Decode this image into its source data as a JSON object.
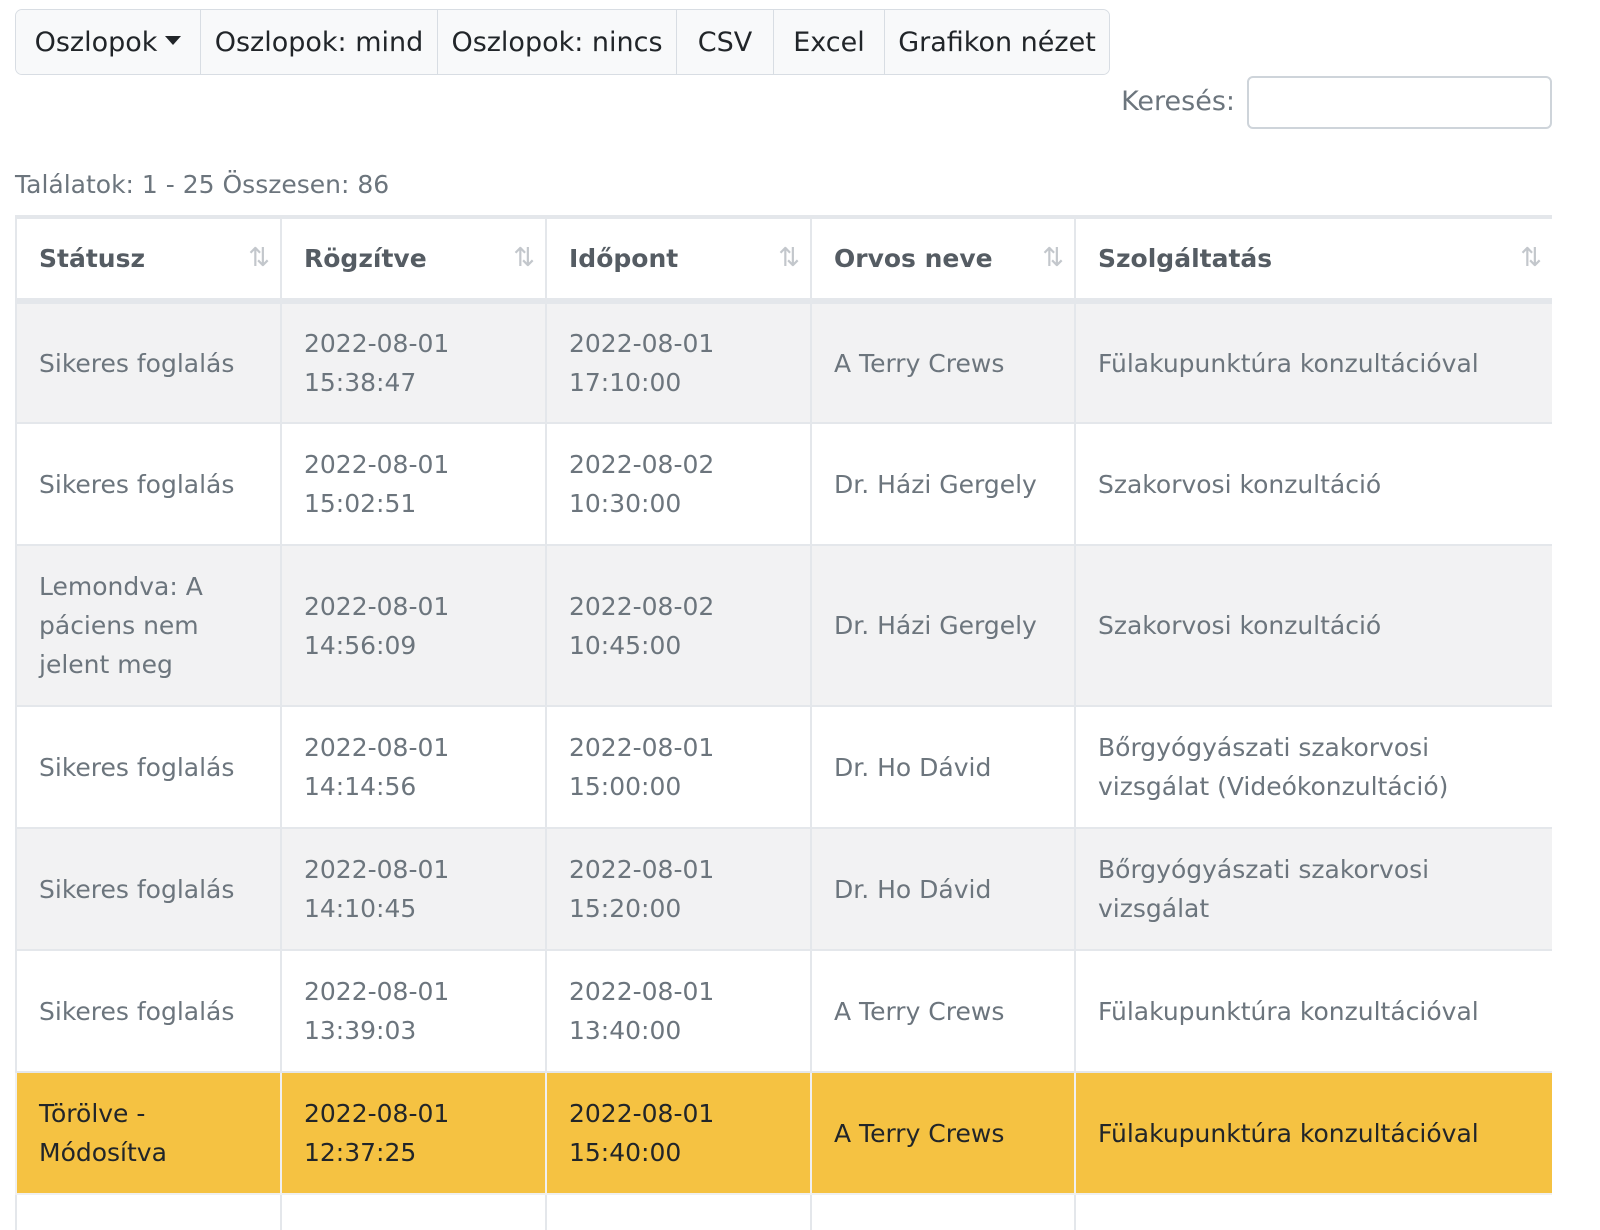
{
  "toolbar": {
    "columns_dropdown": "Oszlopok",
    "columns_all": "Oszlopok: mind",
    "columns_none": "Oszlopok: nincs",
    "csv": "CSV",
    "excel": "Excel",
    "chart_view": "Grafikon nézet"
  },
  "search": {
    "label": "Keresés:",
    "value": ""
  },
  "info": "Találatok: 1 - 25 Összesen: 86",
  "table": {
    "headers": [
      "Státusz",
      "Rögzítve",
      "Időpont",
      "Orvos neve",
      "Szolgáltatás"
    ],
    "rows": [
      {
        "status": "Sikeres foglalás",
        "recorded_date": "2022-08-01",
        "recorded_time": "15:38:47",
        "appt_date": "2022-08-01",
        "appt_time": "17:10:00",
        "doctor": "A Terry Crews",
        "service": "Fülakupunktúra konzultációval"
      },
      {
        "status": "Sikeres foglalás",
        "recorded_date": "2022-08-01",
        "recorded_time": "15:02:51",
        "appt_date": "2022-08-02",
        "appt_time": "10:30:00",
        "doctor": "Dr. Házi Gergely",
        "service": "Szakorvosi konzultáció"
      },
      {
        "status": "Lemondva: A páciens nem jelent meg",
        "recorded_date": "2022-08-01",
        "recorded_time": "14:56:09",
        "appt_date": "2022-08-02",
        "appt_time": "10:45:00",
        "doctor": "Dr. Házi Gergely",
        "service": "Szakorvosi konzultáció"
      },
      {
        "status": "Sikeres foglalás",
        "recorded_date": "2022-08-01",
        "recorded_time": "14:14:56",
        "appt_date": "2022-08-01",
        "appt_time": "15:00:00",
        "doctor": "Dr. Ho Dávid",
        "service": "Bőrgyógyászati szakorvosi vizsgálat (Videókonzultáció)"
      },
      {
        "status": "Sikeres foglalás",
        "recorded_date": "2022-08-01",
        "recorded_time": "14:10:45",
        "appt_date": "2022-08-01",
        "appt_time": "15:20:00",
        "doctor": "Dr. Ho Dávid",
        "service": "Bőrgyógyászati szakorvosi vizsgálat"
      },
      {
        "status": "Sikeres foglalás",
        "recorded_date": "2022-08-01",
        "recorded_time": "13:39:03",
        "appt_date": "2022-08-01",
        "appt_time": "13:40:00",
        "doctor": "A Terry Crews",
        "service": "Fülakupunktúra konzultációval"
      },
      {
        "status": "Törölve - Módosítva",
        "recorded_date": "2022-08-01",
        "recorded_time": "12:37:25",
        "appt_date": "2022-08-01",
        "appt_time": "15:40:00",
        "doctor": "A Terry Crews",
        "service": "Fülakupunktúra konzultációval"
      }
    ]
  },
  "colors": {
    "highlight_row": "#f5c242",
    "striped_row": "#f2f2f3",
    "border": "#e4e7eb"
  },
  "icons": {
    "sort": "sort-arrows-icon",
    "dropdown": "caret-down-icon"
  }
}
